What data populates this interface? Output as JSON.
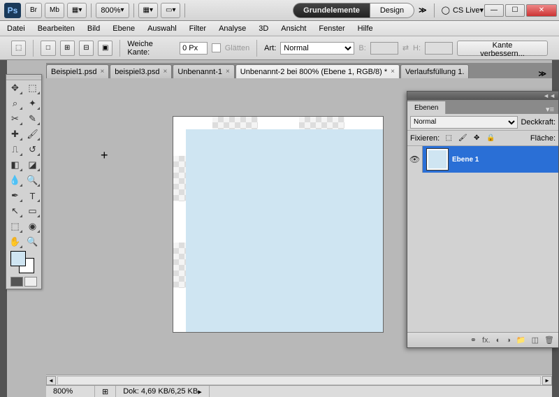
{
  "app": {
    "ps_logo": "Ps"
  },
  "titlebar": {
    "br": "Br",
    "mb": "Mb",
    "zoom": "800%",
    "workspace_active": "Grundelemente",
    "workspace_inactive": "Design",
    "expand": "≫",
    "cslive": "CS Live"
  },
  "menu": {
    "datei": "Datei",
    "bearbeiten": "Bearbeiten",
    "bild": "Bild",
    "ebene": "Ebene",
    "auswahl": "Auswahl",
    "filter": "Filter",
    "analyse": "Analyse",
    "d3": "3D",
    "ansicht": "Ansicht",
    "fenster": "Fenster",
    "hilfe": "Hilfe"
  },
  "options": {
    "feather_label": "Weiche Kante:",
    "feather_value": "0 Px",
    "antialias": "Glätten",
    "style_label": "Art:",
    "style_value": "Normal",
    "width_label": "B:",
    "height_label": "H:",
    "refine": "Kante verbessern..."
  },
  "tabs": [
    {
      "label": "Beispiel1.psd",
      "active": false
    },
    {
      "label": "beispiel3.psd",
      "active": false
    },
    {
      "label": "Unbenannt-1",
      "active": false
    },
    {
      "label": "Unbenannt-2 bei 800% (Ebene 1, RGB/8) *",
      "active": true
    },
    {
      "label": "Verlaufsfüllung 1.",
      "active": false
    }
  ],
  "tabs_more": "≫",
  "status": {
    "zoom": "800%",
    "doc": "Dok: 4,69 KB/6,25 KB"
  },
  "panel": {
    "tab": "Ebenen",
    "blend": "Normal",
    "opacity_label": "Deckkraft:",
    "lock_label": "Fixieren:",
    "fill_label": "Fläche:",
    "layer_name": "Ebene 1",
    "footer_fx": "fx."
  }
}
